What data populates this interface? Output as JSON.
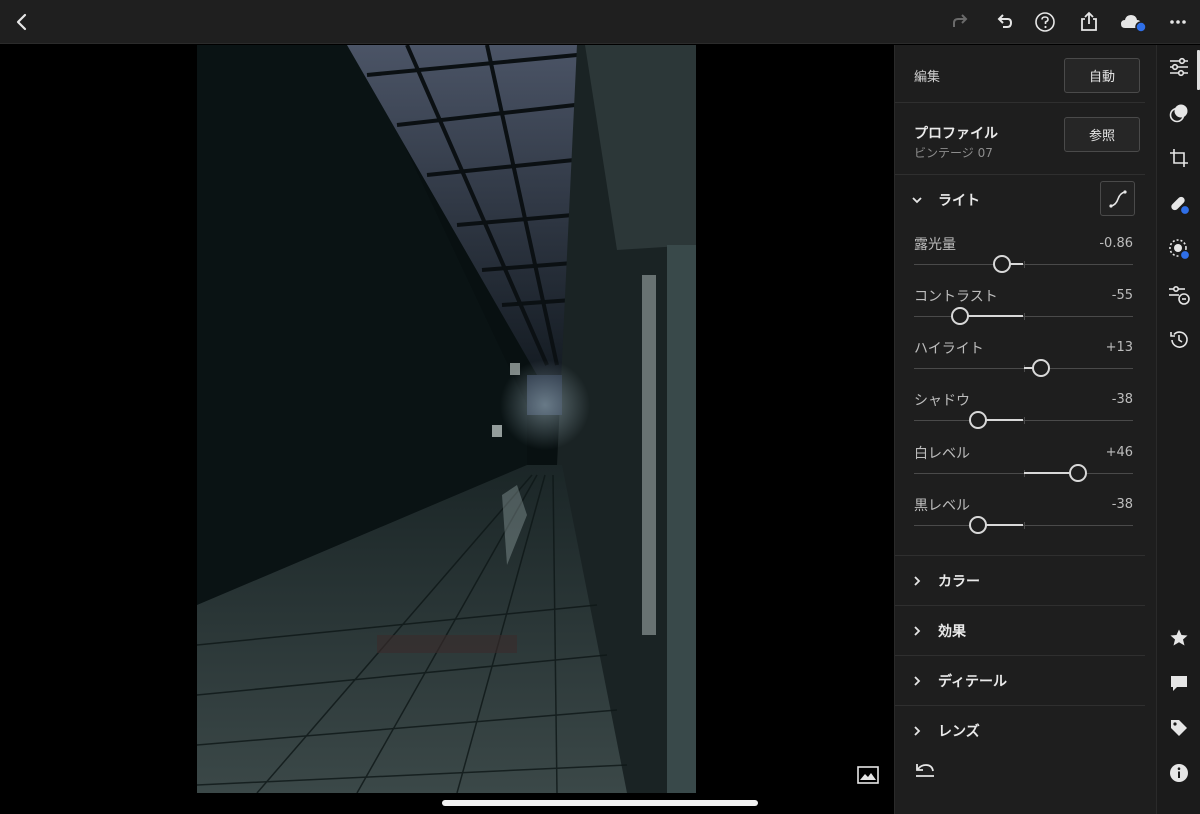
{
  "panel": {
    "edit_label": "編集",
    "auto_button": "自動",
    "profile": {
      "title": "プロファイル",
      "name": "ビンテージ 07",
      "browse_button": "参照"
    },
    "light": {
      "title": "ライト",
      "sliders": [
        {
          "label": "露光量",
          "value": "-0.86",
          "position": 0.4
        },
        {
          "label": "コントラスト",
          "value": "-55",
          "position": 0.21
        },
        {
          "label": "ハイライト",
          "value": "+13",
          "position": 0.58
        },
        {
          "label": "シャドウ",
          "value": "-38",
          "position": 0.29
        },
        {
          "label": "白レベル",
          "value": "+46",
          "position": 0.75
        },
        {
          "label": "黒レベル",
          "value": "-38",
          "position": 0.29
        }
      ]
    },
    "sections": [
      "カラー",
      "効果",
      "ディテール",
      "レンズ"
    ]
  },
  "icons": {
    "back": "chevron-left-icon",
    "redo": "redo-icon",
    "undo": "undo-icon",
    "help": "help-icon",
    "share": "share-icon",
    "cloud": "cloud-sync-icon",
    "more": "more-icon",
    "curve": "tone-curve-icon"
  },
  "colors": {
    "accent": "#2f6fe8",
    "panel": "#1e1e1e",
    "topbar": "#1f1f1f"
  }
}
